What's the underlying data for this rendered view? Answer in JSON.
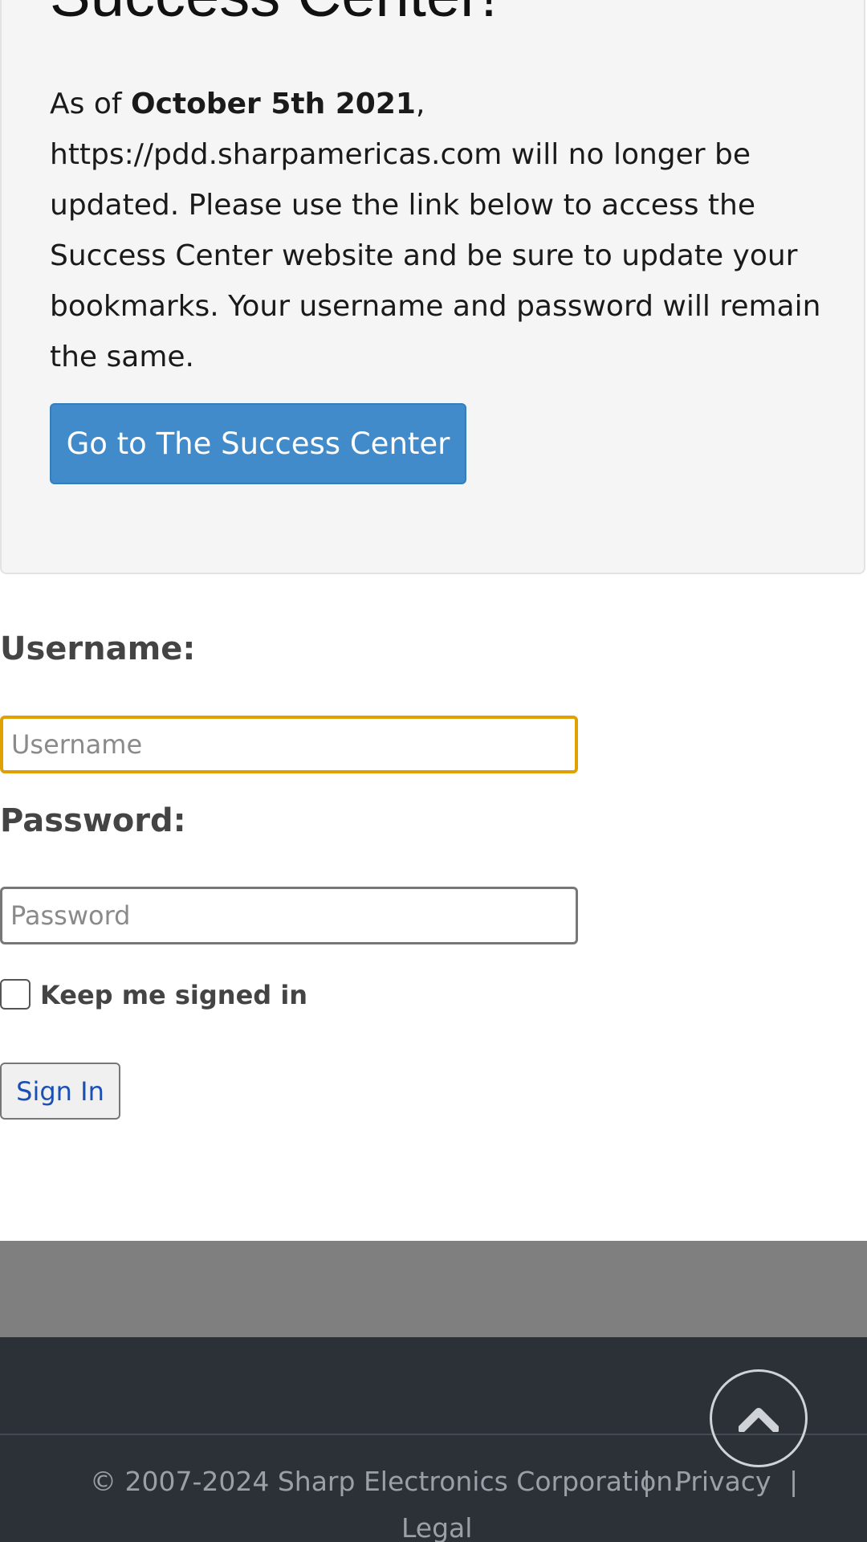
{
  "notice": {
    "heading": "Success Center!",
    "body_prefix": "As of ",
    "date": "October 5th 2021",
    "body_suffix": ", https://pdd.sharpamericas.com will no longer be updated.  Please use the link below to access the Success Center website and be sure to update your bookmarks.  Your username and password will remain the same.",
    "button_label": "Go to The Success Center"
  },
  "login": {
    "username_label": "Username:",
    "username_placeholder": "Username",
    "password_label": "Password:",
    "password_placeholder": "Password",
    "keep_signed_in_label": "Keep me signed in",
    "keep_signed_in_checked": false,
    "sign_in_label": "Sign In"
  },
  "footer": {
    "copyright": "© 2007-2024 Sharp Electronics Corporation.",
    "separator": "|",
    "privacy_label": "Privacy",
    "legal_label": "Legal",
    "scroll_top_icon": "chevron-up-icon"
  },
  "colors": {
    "primary_button": "#428bca",
    "focus_outline": "#e0a100",
    "footer_bg": "#2c3138",
    "band_bg": "#7f7f7f"
  }
}
